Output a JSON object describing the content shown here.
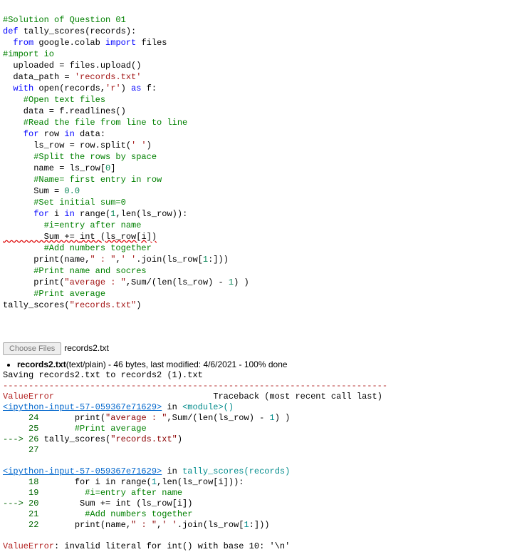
{
  "code": {
    "l1": "#Solution of Question 01",
    "l2a": "def ",
    "l2b": "tally_scores",
    "l2c": "(records):",
    "l3a": "  from ",
    "l3b": "google.colab ",
    "l3c": "import ",
    "l3d": "files",
    "l4": "#import io",
    "l5a": "  uploaded = files.upload()",
    "l6a": "  data_path = ",
    "l6b": "'records.txt'",
    "l7a": "  with ",
    "l7b": "open",
    "l7c": "(records,",
    "l7d": "'r'",
    "l7e": ") ",
    "l7f": "as ",
    "l7g": "f:",
    "l8": "    #Open text files",
    "l9a": "    data = f.readlines()",
    "l10": "    #Read the file from line to line",
    "l11a": "    for ",
    "l11b": "row ",
    "l11c": "in ",
    "l11d": "data:",
    "l12a": "      ls_row = row.split(",
    "l12b": "' '",
    "l12c": ")",
    "l13": "      #Split the rows by space",
    "l14a": "      name = ls_row[",
    "l14b": "0",
    "l14c": "]",
    "l15": "      #Name= first entry in row",
    "l16a": "      Sum = ",
    "l16b": "0.0",
    "l17": "      #Set initial sum=0",
    "l18a": "      for ",
    "l18b": "i ",
    "l18c": "in ",
    "l18d": "range",
    "l18e": "(",
    "l18f": "1",
    "l18g": ",",
    "l18h": "len",
    "l18i": "(ls_row)):",
    "l19": "        #i=entry after name",
    "l20a": "        Sum += ",
    "l20b": "int ",
    "l20c": "(ls_row[i])",
    "l21": "        #Add numbers together",
    "l22a": "      print",
    "l22b": "(name,",
    "l22c": "\" : \"",
    "l22d": ",",
    "l22e": "' '",
    "l22f": ".join(ls_row[",
    "l22g": "1",
    "l22h": ":]))",
    "l23": "      #Print name and socres",
    "l24a": "      print",
    "l24b": "(",
    "l24c": "\"average : \"",
    "l24d": ",Sum/(",
    "l24e": "len",
    "l24f": "(ls_row) - ",
    "l24g": "1",
    "l24h": ") )",
    "l25": "      #Print average",
    "l26a": "tally_scores(",
    "l26b": "\"records.txt\"",
    "l26c": ")"
  },
  "upload": {
    "button": "Choose Files",
    "filename": "records2.txt",
    "info_prefix": "records2.txt",
    "info_rest": "(text/plain) - 46 bytes, last modified: 4/6/2021 - 100% done",
    "saving": "Saving records2.txt to records2 (1).txt"
  },
  "tb": {
    "sep": "---------------------------------------------------------------------------",
    "err_name": "ValueError",
    "err_hdr_rest": "                               Traceback (most recent call last)",
    "link1": "<ipython-input-57-059367e71629>",
    "in1": " in ",
    "mod1": "<module>",
    "par1": "()",
    "f1_l24_num": "     24",
    "f1_l24_code_a": "       print(",
    "f1_l24_code_b": "\"average : \"",
    "f1_l24_code_c": ",Sum/(len(ls_row) - ",
    "f1_l24_code_d": "1",
    "f1_l24_code_e": ") )",
    "f1_l25_num": "     25",
    "f1_l25_code": "       #Print average",
    "f1_l26_arrow": "---> 26",
    "f1_l26_code_a": " tally_scores(",
    "f1_l26_code_b": "\"records.txt\"",
    "f1_l26_code_c": ")",
    "f1_l27_num": "     27",
    "link2": "<ipython-input-57-059367e71629>",
    "in2": " in ",
    "fn2": "tally_scores",
    "par2": "(records)",
    "f2_l18_num": "     18",
    "f2_l18_code_a": "       for i in range(",
    "f2_l18_code_b": "1",
    "f2_l18_code_c": ",len(ls_row[i])):",
    "f2_l19_num": "     19",
    "f2_l19_code": "         #i=entry after name",
    "f2_l20_arrow": "---> 20",
    "f2_l20_code_a": "        Sum += int (ls_row[i])",
    "f2_l21_num": "     21",
    "f2_l21_code": "         #Add numbers together",
    "f2_l22_num": "     22",
    "f2_l22_code_a": "       print(name,",
    "f2_l22_code_b": "\" : \"",
    "f2_l22_code_c": ",",
    "f2_l22_code_d": "' '",
    "f2_l22_code_e": ".join(ls_row[",
    "f2_l22_code_f": "1",
    "f2_l22_code_g": ":]))",
    "final_err": "ValueError",
    "final_msg": ": invalid literal for int() with base 10: '\\n'"
  }
}
